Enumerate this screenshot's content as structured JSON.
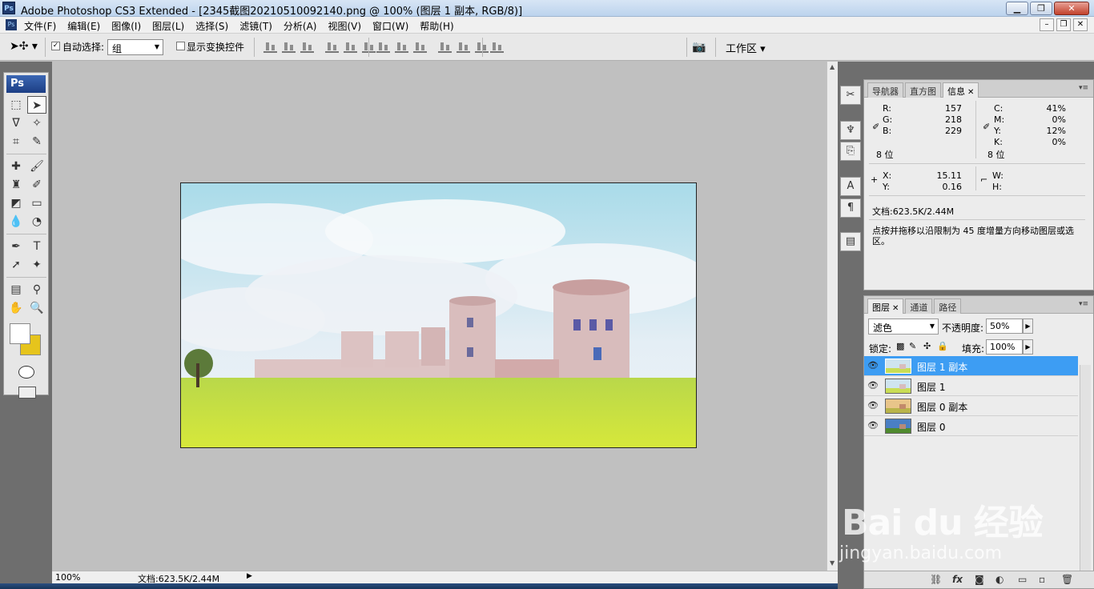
{
  "window": {
    "title": "Adobe Photoshop CS3 Extended - [2345截图20210510092140.png @ 100% (图层 1 副本, RGB/8)]",
    "app_icon_label": "Ps",
    "controls": {
      "minimize": "▁",
      "restore": "❐",
      "close": "✕"
    }
  },
  "menubar": {
    "doc_icon_label": "Ps",
    "items": [
      "文件(F)",
      "编辑(E)",
      "图像(I)",
      "图层(L)",
      "选择(S)",
      "滤镜(T)",
      "分析(A)",
      "视图(V)",
      "窗口(W)",
      "帮助(H)"
    ],
    "doc_controls": {
      "minimize": "–",
      "restore": "❐",
      "close": "✕"
    }
  },
  "options": {
    "auto_select_label": "自动选择:",
    "auto_select_checked": "✓",
    "auto_select_value": "组",
    "show_transform_label": "显示变换控件",
    "workspace_label": "工作区 ▾"
  },
  "toolbox": {
    "logo": "Ps",
    "tools": [
      {
        "name": "marquee-tool",
        "glyph": "⬚"
      },
      {
        "name": "move-tool",
        "glyph": "➤"
      },
      {
        "name": "lasso-tool",
        "glyph": "ᐁ"
      },
      {
        "name": "magic-wand-tool",
        "glyph": "✧"
      },
      {
        "name": "crop-tool",
        "glyph": "⌗"
      },
      {
        "name": "slice-tool",
        "glyph": "✎"
      },
      {
        "name": "healing-brush-tool",
        "glyph": "✚"
      },
      {
        "name": "brush-tool",
        "glyph": "🖌"
      },
      {
        "name": "clone-stamp-tool",
        "glyph": "♜"
      },
      {
        "name": "history-brush-tool",
        "glyph": "✐"
      },
      {
        "name": "eraser-tool",
        "glyph": "◩"
      },
      {
        "name": "gradient-tool",
        "glyph": "▭"
      },
      {
        "name": "blur-tool",
        "glyph": "💧"
      },
      {
        "name": "dodge-tool",
        "glyph": "◔"
      },
      {
        "name": "pen-tool",
        "glyph": "✒"
      },
      {
        "name": "type-tool",
        "glyph": "T"
      },
      {
        "name": "path-selection-tool",
        "glyph": "➚"
      },
      {
        "name": "custom-shape-tool",
        "glyph": "✦"
      },
      {
        "name": "notes-tool",
        "glyph": "▤"
      },
      {
        "name": "eyedropper-tool",
        "glyph": "⚲"
      },
      {
        "name": "hand-tool",
        "glyph": "✋"
      },
      {
        "name": "zoom-tool",
        "glyph": "🔍"
      }
    ],
    "foreground_color": "#ffffff",
    "background_color": "#e6c41c"
  },
  "status": {
    "zoom": "100%",
    "doc": "文档:623.5K/2.44M"
  },
  "info_panel": {
    "tabs": [
      "导航器",
      "直方图",
      "信息"
    ],
    "r_label": "R:",
    "r_value": "157",
    "g_label": "G:",
    "g_value": "218",
    "b_label": "B:",
    "b_value": "229",
    "c_label": "C:",
    "c_value": "41%",
    "m_label": "M:",
    "m_value": "0%",
    "y_label": "Y:",
    "y_value": "12%",
    "k_label": "K:",
    "k_value": "0%",
    "bits_left": "8 位",
    "bits_right": "8 位",
    "x_label": "X:",
    "x_value": "15.11",
    "yy_label": "Y:",
    "yy_value": "0.16",
    "w_label": "W:",
    "h_label": "H:",
    "doc": "文档:623.5K/2.44M",
    "hint": "点按并拖移以沿限制为 45 度增量方向移动图层或选区。"
  },
  "layers_panel": {
    "tabs": [
      "图层",
      "通道",
      "路径"
    ],
    "blend_mode": "滤色",
    "opacity_label": "不透明度:",
    "opacity_value": "50%",
    "lock_label": "锁定:",
    "fill_label": "填充:",
    "fill_value": "100%",
    "layers": [
      {
        "name": "图层 1 副本",
        "active": true
      },
      {
        "name": "图层 1",
        "active": false
      },
      {
        "name": "图层 0 副本",
        "active": false
      },
      {
        "name": "图层 0",
        "active": false
      }
    ]
  },
  "watermark": {
    "brand": "Bai du 经验",
    "url": "jingyan.baidu.com"
  }
}
